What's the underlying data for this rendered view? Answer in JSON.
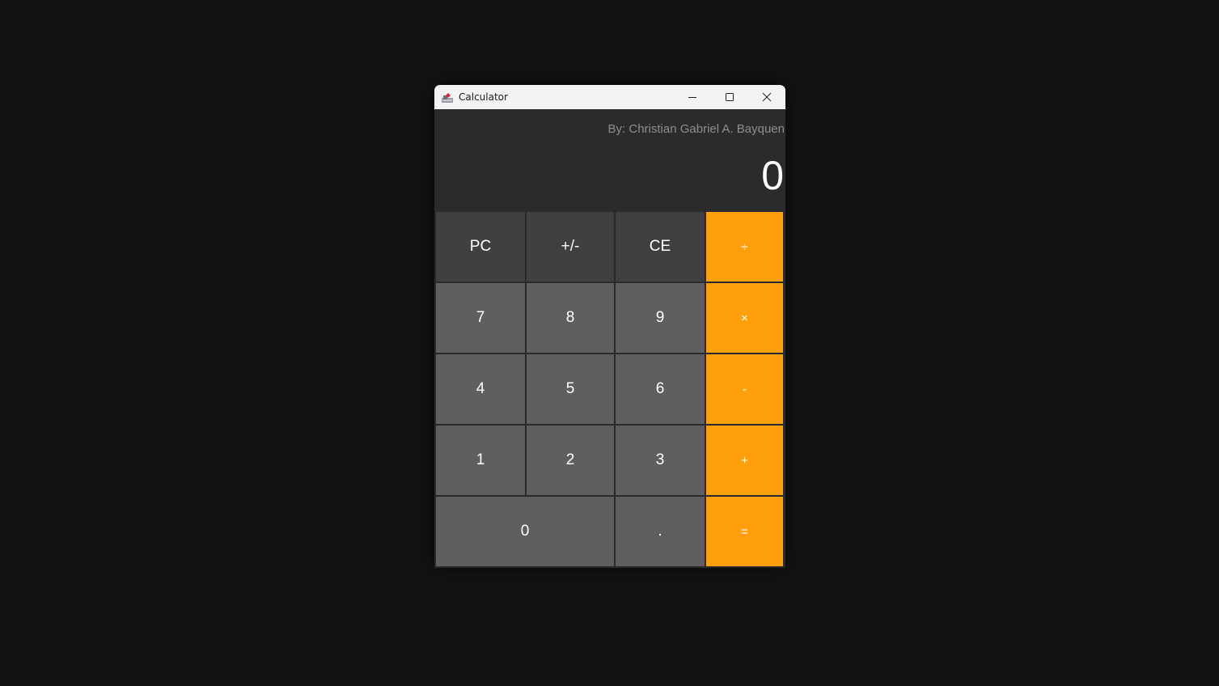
{
  "window": {
    "title": "Calculator",
    "controls": {
      "minimize_icon": "minimize-icon",
      "maximize_icon": "maximize-icon",
      "close_icon": "close-icon"
    }
  },
  "display": {
    "credit": "By: Christian Gabriel A. Bayquen",
    "value": "0"
  },
  "keys": {
    "pc": "PC",
    "sign": "+/-",
    "ce": "CE",
    "divide": "÷",
    "seven": "7",
    "eight": "8",
    "nine": "9",
    "multiply": "×",
    "four": "4",
    "five": "5",
    "six": "6",
    "subtract": "-",
    "one": "1",
    "two": "2",
    "three": "3",
    "add": "+",
    "zero": "0",
    "decimal": ".",
    "equals": "="
  },
  "colors": {
    "background": "#121212",
    "display_bg": "#2b2b2d",
    "function_key": "#404042",
    "number_key": "#5f5f61",
    "operator_key": "#ff9f0c",
    "credit_text": "#8e8e90"
  }
}
